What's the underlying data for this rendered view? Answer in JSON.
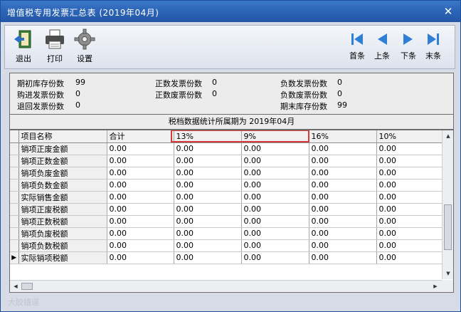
{
  "window": {
    "title": "增值税专用发票汇总表 (2019年04月)",
    "close_glyph": "✕"
  },
  "toolbar": {
    "exit_label": "退出",
    "print_label": "打印",
    "settings_label": "设置",
    "first_label": "首条",
    "prev_label": "上条",
    "next_label": "下条",
    "last_label": "末条"
  },
  "summary": {
    "opening_stock_label": "期初库存份数",
    "opening_stock_value": "99",
    "purchased_label": "购进发票份数",
    "purchased_value": "0",
    "returned_label": "退回发票份数",
    "returned_value": "0",
    "positive_issued_label": "正数发票份数",
    "positive_issued_value": "0",
    "positive_void_label": "正数废票份数",
    "positive_void_value": "0",
    "negative_issued_label": "负数发票份数",
    "negative_issued_value": "0",
    "negative_void_label": "负数废票份数",
    "negative_void_value": "0",
    "closing_stock_label": "期末库存份数",
    "closing_stock_value": "99",
    "period_label": "税档数据统计所属期为",
    "period_value": "2019年04月"
  },
  "grid": {
    "columns": [
      "项目名称",
      "合计",
      "13%",
      "9%",
      "16%",
      "10%"
    ],
    "rows": [
      [
        "销项正废金额",
        "0.00",
        "0.00",
        "0.00",
        "0.00",
        "0.00"
      ],
      [
        "销项正数金额",
        "0.00",
        "0.00",
        "0.00",
        "0.00",
        "0.00"
      ],
      [
        "销项负废金额",
        "0.00",
        "0.00",
        "0.00",
        "0.00",
        "0.00"
      ],
      [
        "销项负数金额",
        "0.00",
        "0.00",
        "0.00",
        "0.00",
        "0.00"
      ],
      [
        "实际销售金额",
        "0.00",
        "0.00",
        "0.00",
        "0.00",
        "0.00"
      ],
      [
        "销项正废税额",
        "0.00",
        "0.00",
        "0.00",
        "0.00",
        "0.00"
      ],
      [
        "销项正数税额",
        "0.00",
        "0.00",
        "0.00",
        "0.00",
        "0.00"
      ],
      [
        "销项负废税额",
        "0.00",
        "0.00",
        "0.00",
        "0.00",
        "0.00"
      ],
      [
        "销项负数税额",
        "0.00",
        "0.00",
        "0.00",
        "0.00",
        "0.00"
      ],
      [
        "实际销项税额",
        "0.00",
        "0.00",
        "0.00",
        "0.00",
        "0.00"
      ]
    ],
    "current_row_marker": "▶",
    "highlight_color": "#d43a3a"
  },
  "watermark": "大胶错误",
  "icons": [
    "exit-icon",
    "printer-icon",
    "gear-icon",
    "first-record-icon",
    "prev-record-icon",
    "next-record-icon",
    "last-record-icon"
  ]
}
